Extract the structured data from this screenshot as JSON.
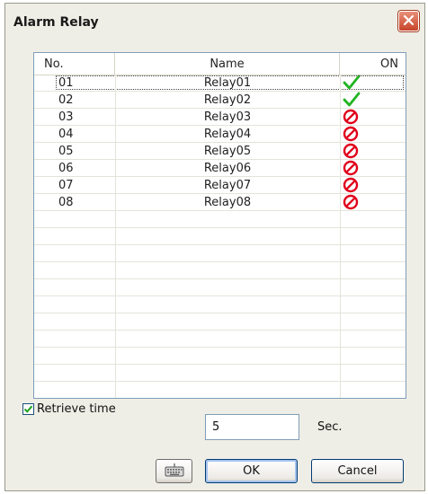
{
  "dialog": {
    "title": "Alarm Relay"
  },
  "columns": [
    "No.",
    "Name",
    "ON"
  ],
  "relays": [
    {
      "no": "01",
      "name": "Relay01",
      "on": true
    },
    {
      "no": "02",
      "name": "Relay02",
      "on": true
    },
    {
      "no": "03",
      "name": "Relay03",
      "on": false
    },
    {
      "no": "04",
      "name": "Relay04",
      "on": false
    },
    {
      "no": "05",
      "name": "Relay05",
      "on": false
    },
    {
      "no": "06",
      "name": "Relay06",
      "on": false
    },
    {
      "no": "07",
      "name": "Relay07",
      "on": false
    },
    {
      "no": "08",
      "name": "Relay08",
      "on": false
    }
  ],
  "retrieve": {
    "checked": true,
    "label": "Retrieve time",
    "value": "5",
    "unit": "Sec."
  },
  "buttons": {
    "keyboard_icon": "keyboard-icon",
    "ok": "OK",
    "cancel": "Cancel"
  },
  "colors": {
    "dialog_bg": "#efeee6",
    "on_check": "#22b422",
    "off_icon": "#e0001a",
    "close_button": "#d05a3d"
  }
}
